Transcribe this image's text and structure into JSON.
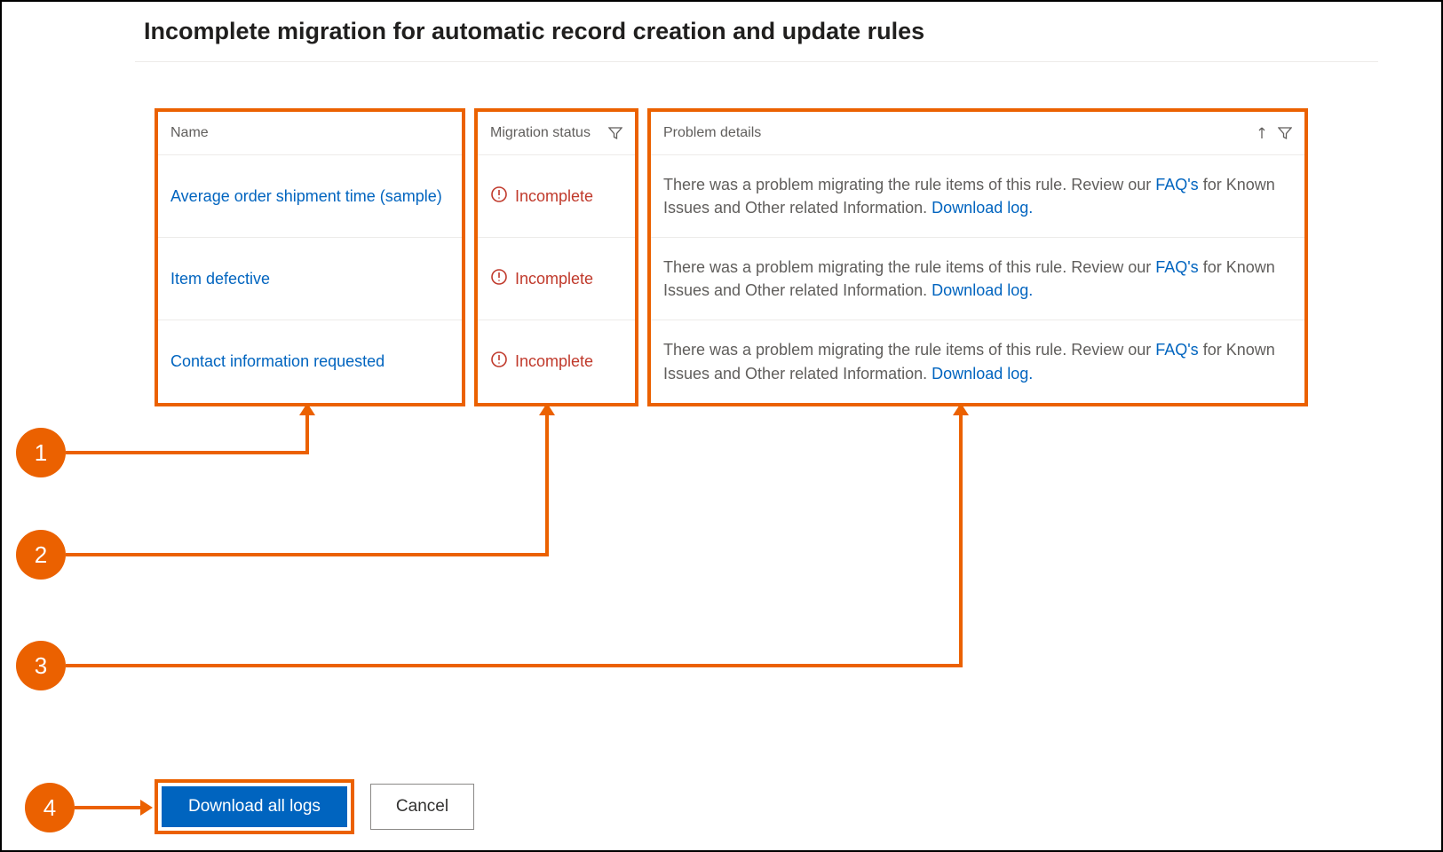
{
  "page": {
    "title": "Incomplete migration for automatic record creation and update rules"
  },
  "columns": {
    "name": "Name",
    "status": "Migration status",
    "details": "Problem details"
  },
  "rows": [
    {
      "name": "Average order shipment time (sample)",
      "status": "Incomplete",
      "details_prefix": "There was a problem migrating the rule items of this rule. Review our ",
      "faq_link": "FAQ's",
      "details_mid": " for Known Issues and Other related Information. ",
      "log_link": "Download log."
    },
    {
      "name": "Item defective",
      "status": "Incomplete",
      "details_prefix": "There was a problem migrating the rule items of this rule. Review our ",
      "faq_link": "FAQ's",
      "details_mid": " for Known Issues and Other related Information. ",
      "log_link": "Download log."
    },
    {
      "name": "Contact information requested",
      "status": "Incomplete",
      "details_prefix": "There was a problem migrating the rule items of this rule. Review our ",
      "faq_link": "FAQ's",
      "details_mid": " for Known Issues and Other related Information. ",
      "log_link": "Download log."
    }
  ],
  "buttons": {
    "download_all": "Download all logs",
    "cancel": "Cancel"
  },
  "annotations": {
    "b1": "1",
    "b2": "2",
    "b3": "3",
    "b4": "4"
  }
}
